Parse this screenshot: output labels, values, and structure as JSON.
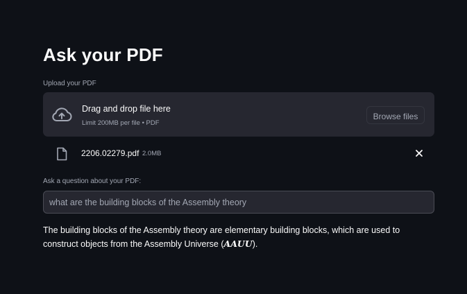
{
  "page": {
    "title": "Ask your PDF"
  },
  "uploader": {
    "label": "Upload your PDF",
    "drop_text": "Drag and drop file here",
    "limit_text": "Limit 200MB per file • PDF",
    "browse_label": "Browse files",
    "icon": "cloud-upload-icon"
  },
  "uploaded_file": {
    "name": "2206.02279.pdf",
    "size": "2.0MB",
    "icon": "file-icon",
    "remove_icon": "close-icon"
  },
  "question": {
    "label": "Ask a question about your PDF:",
    "value": "what are the building blocks of the Assembly theory"
  },
  "answer": {
    "text_before": "The building blocks of the Assembly theory are elementary building blocks, which are used to construct objects from the Assembly Universe (",
    "math": "AAUU",
    "text_after": ")."
  },
  "colors": {
    "background": "#0e1117",
    "surface": "#262730",
    "text": "#fafafa",
    "muted_text": "#a3a8b4"
  }
}
